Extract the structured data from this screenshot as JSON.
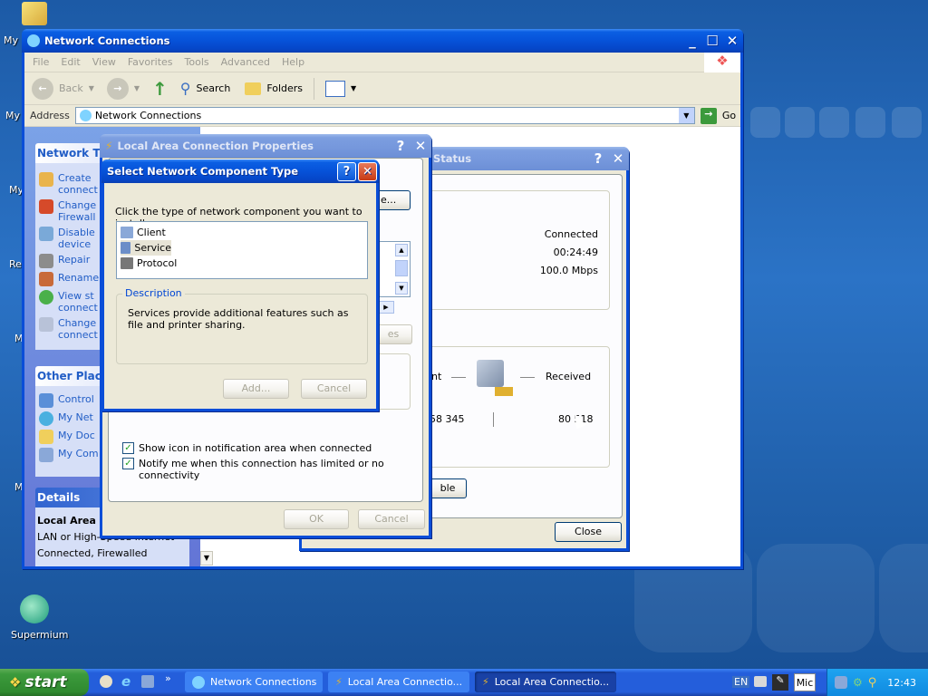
{
  "desktop": {
    "icons": [
      {
        "label": "My I"
      },
      {
        "label": "My"
      },
      {
        "label": "My"
      },
      {
        "label": "Re"
      },
      {
        "label": "M"
      },
      {
        "label": "M"
      },
      {
        "label": "Supermium"
      }
    ]
  },
  "explorer": {
    "title": "Network Connections",
    "menu": [
      "File",
      "Edit",
      "View",
      "Favorites",
      "Tools",
      "Advanced",
      "Help"
    ],
    "toolbar": {
      "back": "Back",
      "search": "Search",
      "folders": "Folders"
    },
    "address": {
      "label": "Address",
      "value": "Network Connections",
      "go": "Go"
    },
    "network_tasks": {
      "header": "Network T",
      "items": [
        "Create",
        "connect",
        "Change",
        "Firewall",
        "Disable",
        "device",
        "Repair",
        "Rename",
        "View st",
        "connect",
        "Change",
        "connect"
      ]
    },
    "other_places": {
      "header": "Other Plac",
      "items": [
        "Control",
        "My Net",
        "My Doc",
        "My Com"
      ]
    },
    "details": {
      "header": "Details",
      "name": "Local Area",
      "type": "LAN or High-Speed Internet",
      "status": "Connected, Firewalled"
    }
  },
  "status_dialog": {
    "title": "Status",
    "connection_status": "Connected",
    "duration": "00:24:49",
    "speed": "100.0 Mbps",
    "sent_label": "nt",
    "received_label": "Received",
    "sent_value": "58 345",
    "received_value": "80 518",
    "disable_btn": "ble",
    "close_btn": "Close"
  },
  "properties_dialog": {
    "title": "Local Area Connection Properties",
    "partial_btn": "e...",
    "partial_btn2": "es",
    "show_icon": "Show icon in notification area when connected",
    "notify": "Notify me when this connection has limited or no connectivity",
    "ok": "OK",
    "cancel": "Cancel"
  },
  "select_dialog": {
    "title": "Select Network Component Type",
    "prompt": "Click the type of network component you want to install:",
    "items": [
      "Client",
      "Service",
      "Protocol"
    ],
    "selected": "Service",
    "description_label": "Description",
    "description": "Services provide additional features such as file and printer sharing.",
    "add": "Add...",
    "cancel": "Cancel"
  },
  "taskbar": {
    "start": "start",
    "tasks": [
      "Network Connections",
      "Local Area Connectio...",
      "Local Area Connectio..."
    ],
    "lang": "EN",
    "mic": "Mic",
    "clock": "12:43"
  },
  "colors": {
    "title_blue": "#0652d9",
    "start_green": "#3c9a3c",
    "taskbar_blue": "#245edb",
    "task_link": "#215dc6"
  }
}
